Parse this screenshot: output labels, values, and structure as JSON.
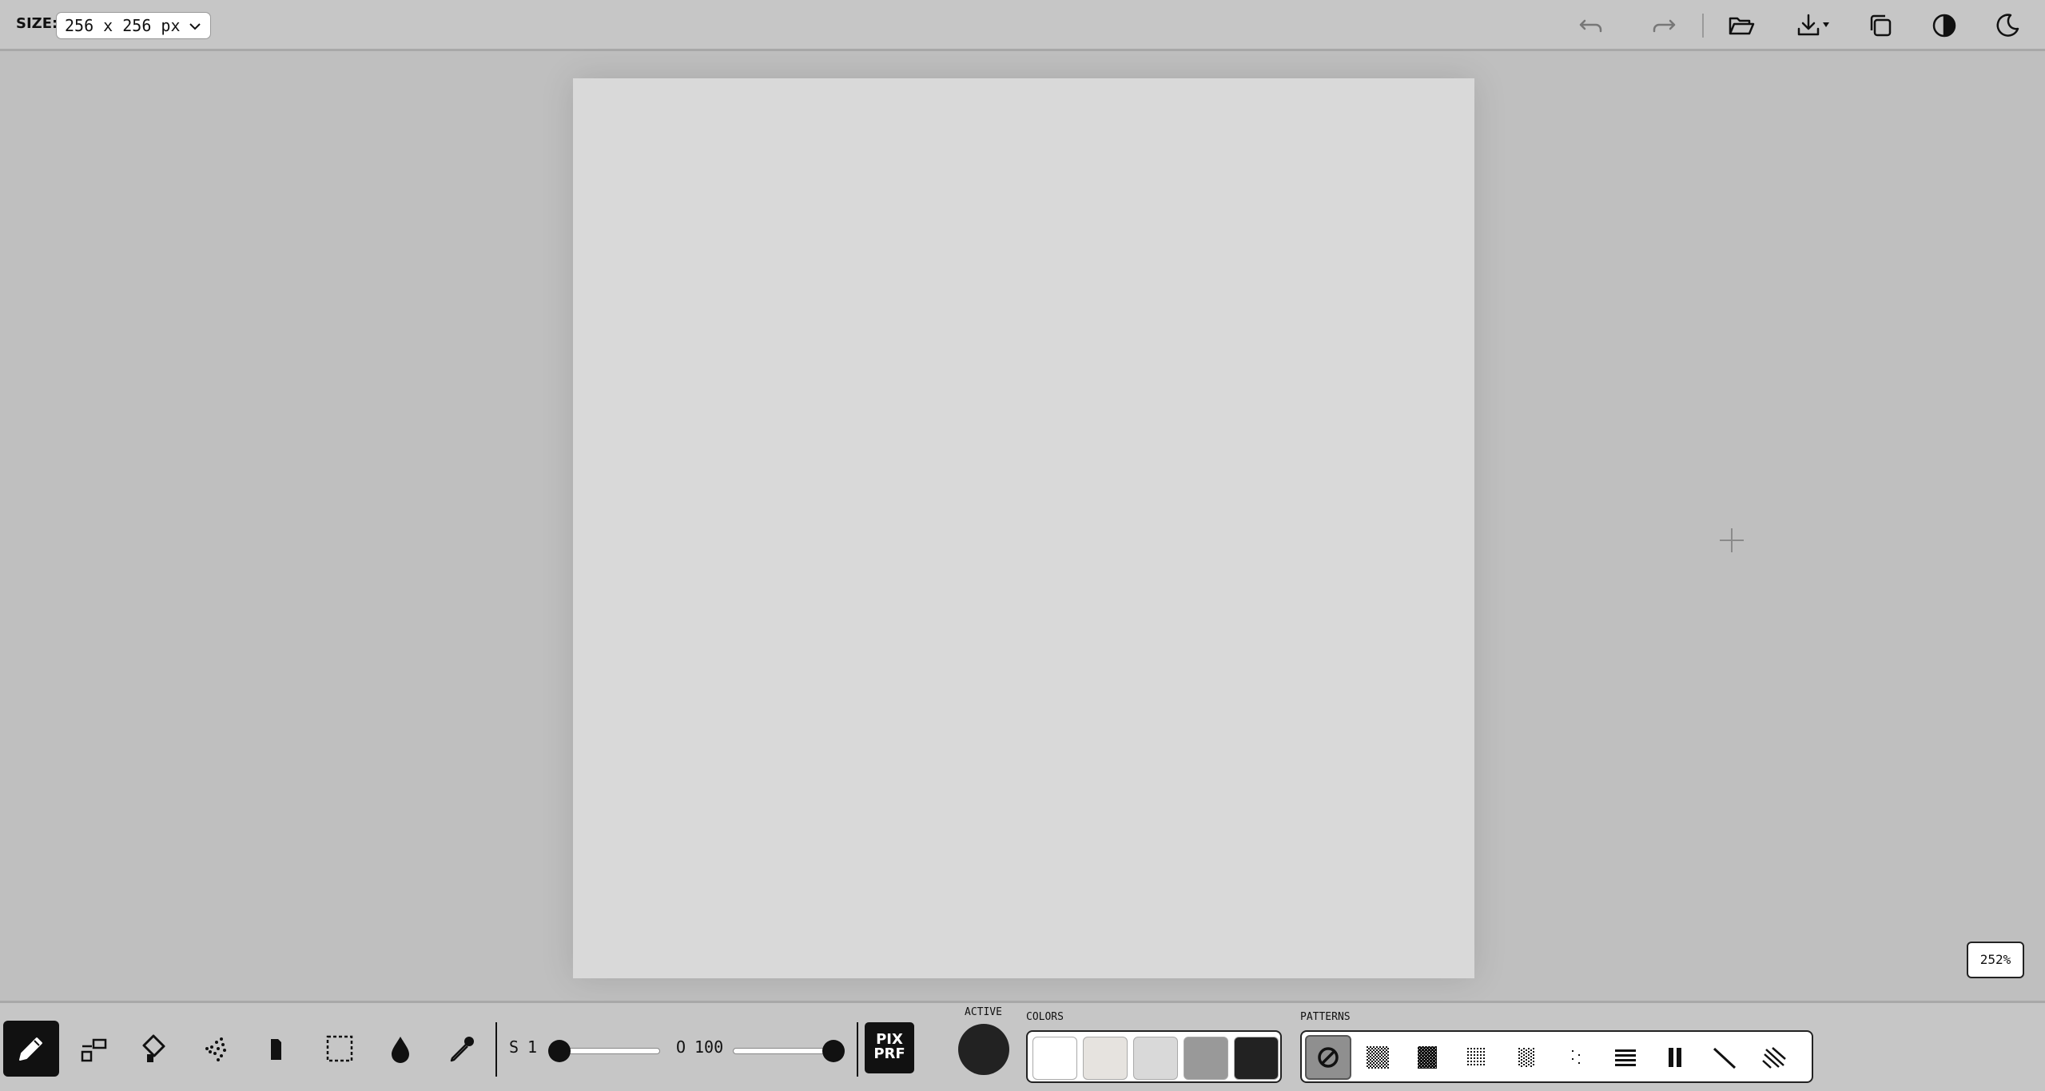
{
  "topbar": {
    "size_label": "SIZE:",
    "size_value": "256 x 256 px",
    "icons": [
      "undo-icon",
      "redo-icon",
      "open-folder-icon",
      "download-icon",
      "copy-icon",
      "contrast-icon",
      "dark-mode-icon"
    ]
  },
  "canvas": {
    "zoom": "252%"
  },
  "toolbar": {
    "tools": [
      "pencil",
      "shapes",
      "fill-bucket",
      "spray",
      "eraser",
      "selection",
      "drop",
      "eyedropper"
    ],
    "active_tool": "pencil",
    "size_label": "S",
    "size_value": "1",
    "opacity_label": "O",
    "opacity_value": "100",
    "size_fraction": 0,
    "opacity_fraction": 1,
    "logo_line1": "PIX",
    "logo_line2": "PRF",
    "active_label": "ACTIVE",
    "active_color": "#222222",
    "colors_label": "COLORS",
    "colors": [
      "#ffffff",
      "#e6e3df",
      "#d9d9d9",
      "#999999",
      "#222222"
    ],
    "patterns_label": "PATTERNS",
    "patterns": [
      "none",
      "checker",
      "dense-checker",
      "grid-dots",
      "sparse-dots",
      "scatter-dots",
      "horizontal-lines",
      "vertical-bars",
      "diagonal-line",
      "diagonal-lines"
    ],
    "selected_pattern": "none"
  }
}
